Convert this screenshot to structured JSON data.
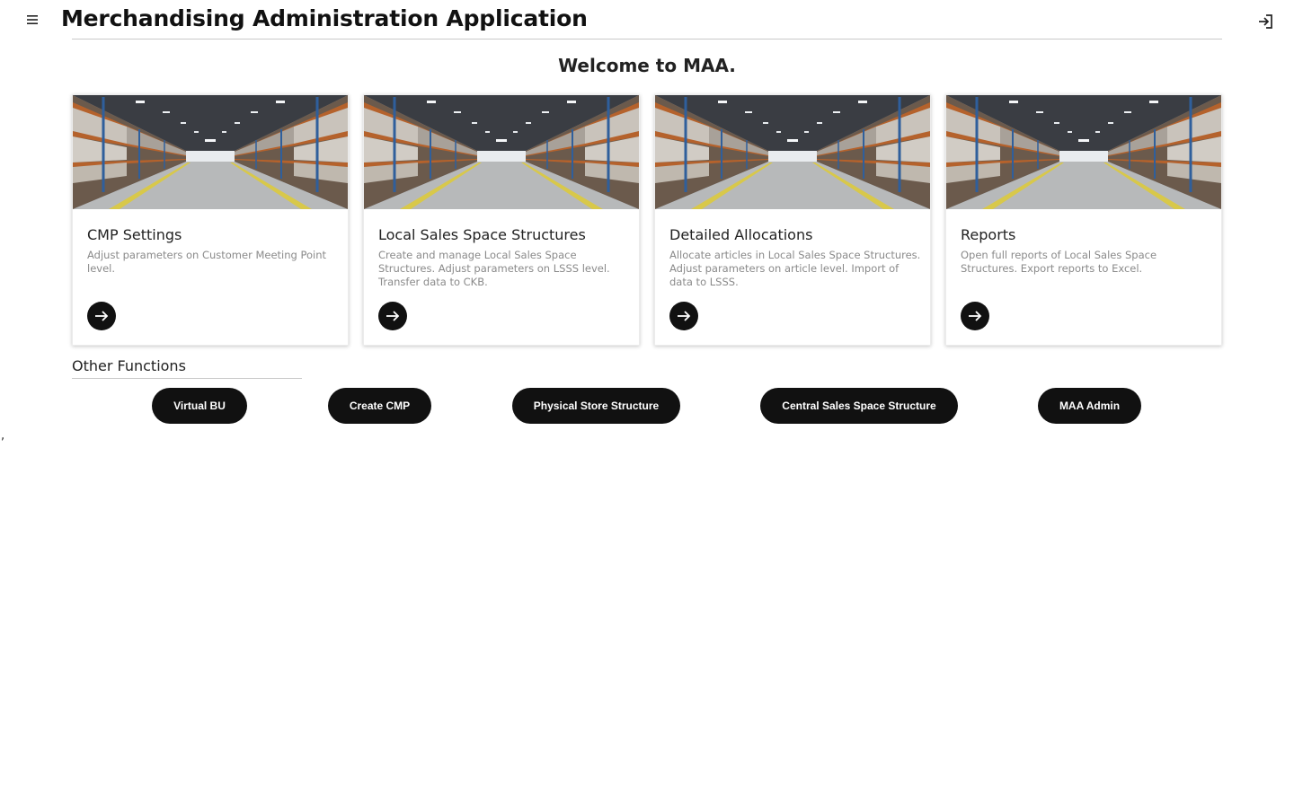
{
  "header": {
    "menu_icon": "hamburger-menu-icon",
    "title": "Merchandising Administration Application",
    "login_icon": "login-icon"
  },
  "welcome": "Welcome to MAA.",
  "cards": [
    {
      "title": "CMP Settings",
      "description": "Adjust parameters on Customer Meeting Point level.",
      "image": "warehouse-aisle-photo",
      "action_icon": "arrow-right-icon"
    },
    {
      "title": "Local Sales Space Structures",
      "description": "Create and manage Local Sales Space Structures. Adjust parameters on LSSS level. Transfer data to CKB.",
      "image": "warehouse-aisle-photo",
      "action_icon": "arrow-right-icon"
    },
    {
      "title": "Detailed Allocations",
      "description": "Allocate articles in Local Sales Space Structures. Adjust parameters on article level. Import of data to LSSS.",
      "image": "warehouse-aisle-photo",
      "action_icon": "arrow-right-icon"
    },
    {
      "title": "Reports",
      "description": "Open full reports of Local Sales Space Structures. Export reports to Excel.",
      "image": "warehouse-aisle-photo",
      "action_icon": "arrow-right-icon"
    }
  ],
  "other_functions": {
    "title": "Other Functions",
    "buttons": [
      "Virtual BU",
      "Create CMP",
      "Physical Store Structure",
      "Central Sales Space Structure",
      "MAA Admin"
    ]
  },
  "stray_text": ",",
  "colors": {
    "button_bg": "#111111",
    "button_text": "#ffffff",
    "description_text": "#8a8a8a",
    "divider": "#c9c9c9"
  }
}
